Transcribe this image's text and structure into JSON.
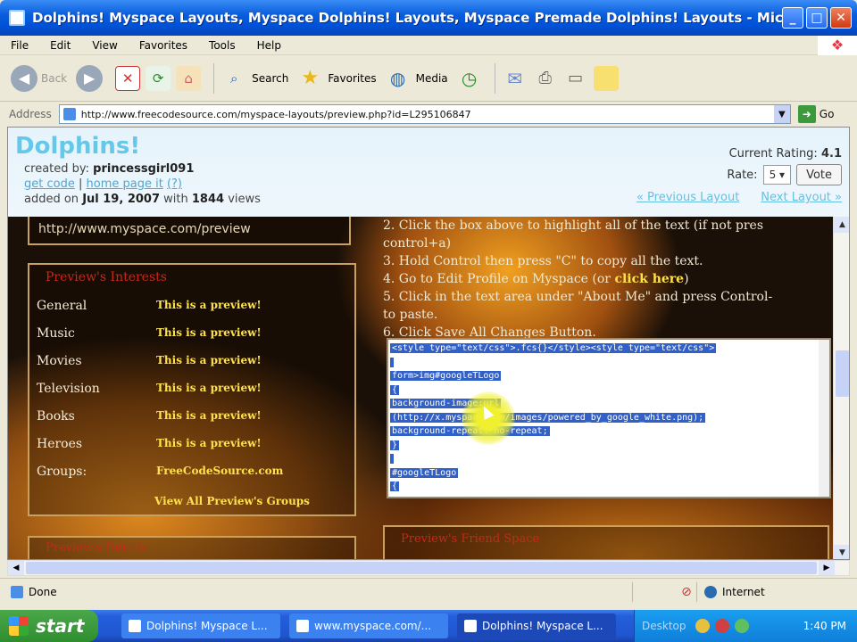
{
  "window": {
    "title": "Dolphins! Myspace Layouts, Myspace Dolphins! Layouts, Myspace Premade Dolphins! Layouts - Microsoft Intern..."
  },
  "menu": [
    "File",
    "Edit",
    "View",
    "Favorites",
    "Tools",
    "Help"
  ],
  "toolbar": {
    "back": "Back",
    "search": "Search",
    "favorites": "Favorites",
    "media": "Media"
  },
  "address": {
    "label": "Address",
    "url": "http://www.freecodesource.com/myspace-layouts/preview.php?id=L295106847",
    "go": "Go"
  },
  "header": {
    "title": "Dolphins!",
    "created_by_label": "created by:",
    "author": "princessgirl091",
    "get_code": "get code",
    "sep": "|",
    "home_page": "home page it",
    "help": "(?)",
    "added_prefix": "added on",
    "date": "Jul 19, 2007",
    "with": "with",
    "views": "1844",
    "views_label": "views",
    "rating_label": "Current Rating:",
    "rating": "4.1",
    "rate_label": "Rate:",
    "rate_value": "5",
    "vote": "Vote",
    "prev": "« Previous Layout",
    "next": "Next Layout »"
  },
  "profile": {
    "url_text": "http://www.myspace.com/preview",
    "interests_title": "Preview's Interests",
    "interests": [
      {
        "k": "General",
        "v": "This is a preview!"
      },
      {
        "k": "Music",
        "v": "This is a preview!"
      },
      {
        "k": "Movies",
        "v": "This is a preview!"
      },
      {
        "k": "Television",
        "v": "This is a preview!"
      },
      {
        "k": "Books",
        "v": "This is a preview!"
      },
      {
        "k": "Heroes",
        "v": "This is a preview!"
      },
      {
        "k": "Groups:",
        "v": "FreeCodeSource.com"
      }
    ],
    "view_all": "View All Preview's Groups",
    "left_bottom_title": "Preview's Details",
    "right_bottom_title": "Preview's Friend Space"
  },
  "instructions": {
    "line2a": "2. Click the box above to highlight all of the text (if not pres",
    "line2b": "control+a)",
    "line3": "3. Hold Control then press \"C\" to copy all the text.",
    "line4a": "4. Go to Edit Profile on Myspace (or ",
    "line4link": "click here",
    "line4b": ")",
    "line5": "5. Click in the text area under \"About Me\" and press Control-",
    "line5b": "to paste.",
    "line6": "6. Click Save All Changes Button."
  },
  "code": [
    "<style type=\"text/css\">.fcs{}</style><style type=\"text/css\">",
    "",
    "form>img#googleTLogo",
    "{",
    "        background-image:url",
    "(http://x.myspace.com/images/powered_by_google_white.png);",
    "        background-repeat: no-repeat;",
    "}",
    "",
    "#googleTLogo",
    "{"
  ],
  "status": {
    "text": "Done",
    "zone": "Internet"
  },
  "taskbar": {
    "start": "start",
    "tasks": [
      "Dolphins! Myspace L...",
      "www.myspace.com/...",
      "Dolphins! Myspace L..."
    ],
    "desktop": "Desktop",
    "clock": "1:40 PM"
  }
}
